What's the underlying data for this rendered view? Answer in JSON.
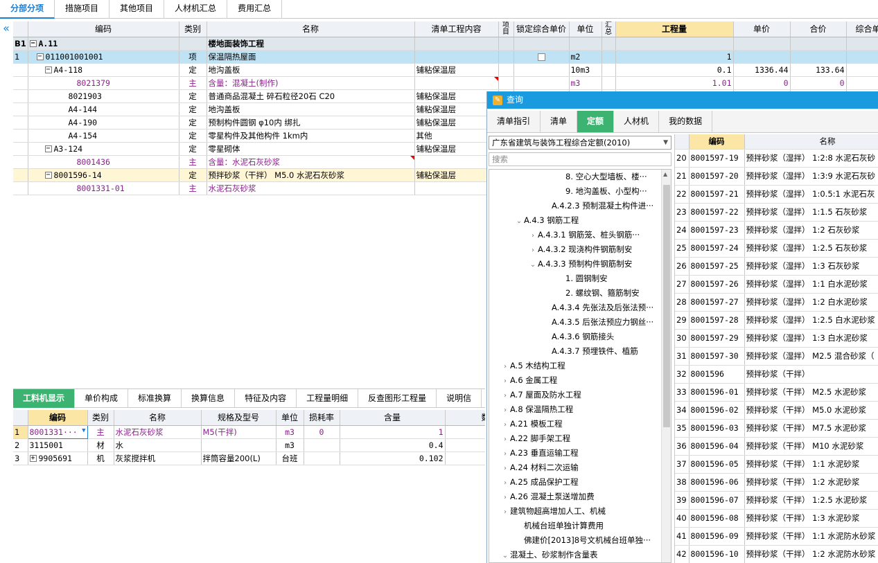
{
  "top_tabs": [
    "分部分项",
    "措施项目",
    "其他项目",
    "人材机汇总",
    "费用汇总"
  ],
  "upper_headers": [
    "编码",
    "类别",
    "名称",
    "清单工程内容",
    "项目",
    "锁定综合单价",
    "单位",
    "汇总",
    "工程量",
    "单价",
    "合价",
    "综合单"
  ],
  "upper_rows": [
    {
      "no": "B1",
      "toggle": "−",
      "code": "A.11",
      "type": "",
      "name": "楼地面装饰工程",
      "content": "",
      "unit": "",
      "qty": "",
      "price": "",
      "total": "",
      "comp": ""
    },
    {
      "no": "1",
      "toggle": "−",
      "code": "011001001001",
      "type": "项",
      "name": "保温隔热屋面",
      "content": "",
      "unit": "m2",
      "qty": "1",
      "price": "",
      "total": "",
      "comp": ""
    },
    {
      "no": "",
      "toggle": "−",
      "code": "A4-118",
      "type": "定",
      "name": "地沟盖板",
      "content": "铺粘保温层",
      "unit": "10m3",
      "qty": "0.1",
      "price": "1336.44",
      "total": "133.64",
      "comp": "1"
    },
    {
      "no": "",
      "toggle": "",
      "code": "8021379",
      "type": "主",
      "name": "含量：混凝土(制作)",
      "content": "",
      "unit": "m3",
      "qty": "1.01",
      "price": "0",
      "total": "0",
      "comp": ""
    },
    {
      "no": "",
      "toggle": "",
      "code": "8021903",
      "type": "定",
      "name": "普通商品混凝土 碎石粒径20石 C20",
      "content": "铺粘保温层",
      "unit": "",
      "qty": "",
      "price": "",
      "total": "",
      "comp": ""
    },
    {
      "no": "",
      "toggle": "",
      "code": "A4-144",
      "type": "定",
      "name": "地沟盖板",
      "content": "铺粘保温层",
      "unit": "",
      "qty": "",
      "price": "",
      "total": "",
      "comp": ""
    },
    {
      "no": "",
      "toggle": "",
      "code": "A4-190",
      "type": "定",
      "name": "预制构件圆钢 φ10内 绑扎",
      "content": "铺粘保温层",
      "unit": "",
      "qty": "",
      "price": "",
      "total": "",
      "comp": ""
    },
    {
      "no": "",
      "toggle": "",
      "code": "A4-154",
      "type": "定",
      "name": "零星构件及其他构件 1km内",
      "content": "其他",
      "unit": "",
      "qty": "",
      "price": "",
      "total": "",
      "comp": ""
    },
    {
      "no": "",
      "toggle": "−",
      "code": "A3-124",
      "type": "定",
      "name": "零星砌体",
      "content": "铺粘保温层",
      "unit": "",
      "qty": "",
      "price": "",
      "total": "",
      "comp": ""
    },
    {
      "no": "",
      "toggle": "",
      "code": "8001436",
      "type": "主",
      "name": "含量：水泥石灰砂浆",
      "content": "",
      "unit": "",
      "qty": "",
      "price": "",
      "total": "",
      "comp": ""
    },
    {
      "no": "",
      "toggle": "−",
      "code": "8001596-14",
      "type": "定",
      "name": "预拌砂浆（干拌） M5.0 水泥石灰砂浆",
      "content": "铺粘保温层",
      "unit": "",
      "qty": "",
      "price": "",
      "total": "",
      "comp": ""
    },
    {
      "no": "",
      "toggle": "",
      "code": "8001331-01",
      "type": "主",
      "name": "水泥石灰砂浆",
      "content": "",
      "unit": "",
      "qty": "",
      "price": "",
      "total": "",
      "comp": ""
    }
  ],
  "bottom_tabs": [
    "工料机显示",
    "单价构成",
    "标准换算",
    "换算信息",
    "特征及内容",
    "工程量明细",
    "反查图形工程量",
    "说明信"
  ],
  "lower_headers": [
    "编码",
    "类别",
    "名称",
    "规格及型号",
    "单位",
    "损耗率",
    "含量",
    "数"
  ],
  "lower_rows": [
    {
      "no": "1",
      "code": "8001331···",
      "type": "主",
      "name": "水泥石灰砂浆",
      "spec": "M5(干拌)",
      "unit": "m3",
      "loss": "0",
      "amount": "1"
    },
    {
      "no": "2",
      "code": "3115001",
      "type": "材",
      "name": "水",
      "spec": "",
      "unit": "m3",
      "loss": "",
      "amount": "0.4"
    },
    {
      "no": "3",
      "code": "9905691",
      "type": "机",
      "name": "灰浆搅拌机",
      "spec": "拌筒容量200(L)",
      "unit": "台班",
      "loss": "",
      "amount": "0.102"
    }
  ],
  "dialog": {
    "title": "查询",
    "tabs": [
      "清单指引",
      "清单",
      "定额",
      "人材机",
      "我的数据"
    ],
    "select": "广东省建筑与装饰工程综合定额(2010)",
    "search_placeholder": "搜索",
    "tree": [
      {
        "indent": 5,
        "tg": "",
        "label": "8. 空心大型墙板、楼···"
      },
      {
        "indent": 5,
        "tg": "",
        "label": "9. 地沟盖板、小型构···"
      },
      {
        "indent": 4,
        "tg": "",
        "label": "A.4.2.3 预制混凝土构件进···"
      },
      {
        "indent": 2,
        "tg": "⌄",
        "label": "A.4.3 钢筋工程"
      },
      {
        "indent": 3,
        "tg": "›",
        "label": "A.4.3.1 钢筋笼、桩头钢筋···"
      },
      {
        "indent": 3,
        "tg": "›",
        "label": "A.4.3.2 现浇构件钢筋制安"
      },
      {
        "indent": 3,
        "tg": "⌄",
        "label": "A.4.3.3 预制构件钢筋制安"
      },
      {
        "indent": 5,
        "tg": "",
        "label": "1. 圆钢制安"
      },
      {
        "indent": 5,
        "tg": "",
        "label": "2. 螺纹钢、箍筋制安"
      },
      {
        "indent": 4,
        "tg": "",
        "label": "A.4.3.4 先张法及后张法预···"
      },
      {
        "indent": 4,
        "tg": "",
        "label": "A.4.3.5 后张法预应力钢丝···"
      },
      {
        "indent": 4,
        "tg": "",
        "label": "A.4.3.6 钢筋接头"
      },
      {
        "indent": 4,
        "tg": "",
        "label": "A.4.3.7 预埋铁件、植筋"
      },
      {
        "indent": 1,
        "tg": "›",
        "label": "A.5 木结构工程"
      },
      {
        "indent": 1,
        "tg": "›",
        "label": "A.6 金属工程"
      },
      {
        "indent": 1,
        "tg": "›",
        "label": "A.7 屋面及防水工程"
      },
      {
        "indent": 1,
        "tg": "›",
        "label": "A.8 保温隔热工程"
      },
      {
        "indent": 1,
        "tg": "›",
        "label": "A.21 模板工程"
      },
      {
        "indent": 1,
        "tg": "›",
        "label": "A.22 脚手架工程"
      },
      {
        "indent": 1,
        "tg": "›",
        "label": "A.23 垂直运输工程"
      },
      {
        "indent": 1,
        "tg": "›",
        "label": "A.24 材料二次运输"
      },
      {
        "indent": 1,
        "tg": "›",
        "label": "A.25 成品保护工程"
      },
      {
        "indent": 1,
        "tg": "›",
        "label": "A.26 混凝土泵送增加费"
      },
      {
        "indent": 1,
        "tg": "›",
        "label": "建筑物超高增加人工、机械"
      },
      {
        "indent": 2,
        "tg": "",
        "label": "机械台班单独计算费用"
      },
      {
        "indent": 2,
        "tg": "",
        "label": "佛建价[2013]8号文机械台班单独···"
      },
      {
        "indent": 1,
        "tg": "⌄",
        "label": "混凝土、砂浆制作含量表"
      }
    ],
    "right_headers": [
      "编码",
      "名称"
    ],
    "right_rows": [
      {
        "no": "20",
        "code": "8001597-19",
        "name": "预拌砂浆（湿拌） 1:2:8 水泥石灰砂"
      },
      {
        "no": "21",
        "code": "8001597-20",
        "name": "预拌砂浆（湿拌） 1:3:9 水泥石灰砂"
      },
      {
        "no": "22",
        "code": "8001597-21",
        "name": "预拌砂浆（湿拌） 1:0.5:1 水泥石灰"
      },
      {
        "no": "23",
        "code": "8001597-22",
        "name": "预拌砂浆（湿拌） 1:1.5 石灰砂浆"
      },
      {
        "no": "24",
        "code": "8001597-23",
        "name": "预拌砂浆（湿拌） 1:2 石灰砂浆"
      },
      {
        "no": "25",
        "code": "8001597-24",
        "name": "预拌砂浆（湿拌） 1:2.5 石灰砂浆"
      },
      {
        "no": "26",
        "code": "8001597-25",
        "name": "预拌砂浆（湿拌） 1:3 石灰砂浆"
      },
      {
        "no": "27",
        "code": "8001597-26",
        "name": "预拌砂浆（湿拌） 1:1 白水泥砂浆"
      },
      {
        "no": "28",
        "code": "8001597-27",
        "name": "预拌砂浆（湿拌） 1:2 白水泥砂浆"
      },
      {
        "no": "29",
        "code": "8001597-28",
        "name": "预拌砂浆（湿拌） 1:2.5 白水泥砂浆"
      },
      {
        "no": "30",
        "code": "8001597-29",
        "name": "预拌砂浆（湿拌） 1:3 白水泥砂浆"
      },
      {
        "no": "31",
        "code": "8001597-30",
        "name": "预拌砂浆（湿拌） M2.5 混合砂浆（"
      },
      {
        "no": "32",
        "code": "8001596",
        "name": "预拌砂浆（干拌）"
      },
      {
        "no": "33",
        "code": "8001596-01",
        "name": "预拌砂浆（干拌） M2.5 水泥砂浆"
      },
      {
        "no": "34",
        "code": "8001596-02",
        "name": "预拌砂浆（干拌） M5.0 水泥砂浆"
      },
      {
        "no": "35",
        "code": "8001596-03",
        "name": "预拌砂浆（干拌） M7.5 水泥砂浆"
      },
      {
        "no": "36",
        "code": "8001596-04",
        "name": "预拌砂浆（干拌） M10 水泥砂浆"
      },
      {
        "no": "37",
        "code": "8001596-05",
        "name": "预拌砂浆（干拌） 1:1 水泥砂浆"
      },
      {
        "no": "38",
        "code": "8001596-06",
        "name": "预拌砂浆（干拌） 1:2 水泥砂浆"
      },
      {
        "no": "39",
        "code": "8001596-07",
        "name": "预拌砂浆（干拌） 1:2.5 水泥砂浆"
      },
      {
        "no": "40",
        "code": "8001596-08",
        "name": "预拌砂浆（干拌） 1:3 水泥砂浆"
      },
      {
        "no": "41",
        "code": "8001596-09",
        "name": "预拌砂浆（干拌） 1:1 水泥防水砂浆"
      },
      {
        "no": "42",
        "code": "8001596-10",
        "name": "预拌砂浆（干拌） 1:2 水泥防水砂浆"
      }
    ]
  }
}
